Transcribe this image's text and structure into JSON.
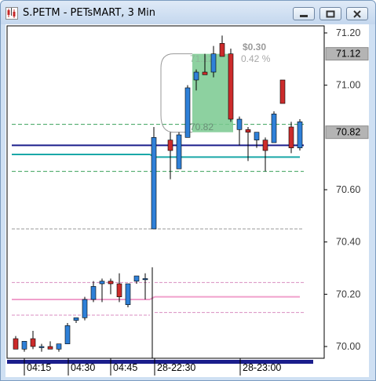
{
  "window": {
    "title": "S.PETM - PETsMART, 3 Min",
    "icons": {
      "app": "candlestick-chart-icon",
      "minimize": "minimize-icon",
      "maximize": "maximize-icon",
      "close": "close-icon"
    }
  },
  "price_axis": {
    "labels": [
      "71.20",
      "71.00",
      "70.60",
      "70.40",
      "70.20",
      "70.00"
    ],
    "values": [
      71.2,
      71.0,
      70.6,
      70.4,
      70.2,
      70.0
    ],
    "markers": [
      {
        "text": "71.12",
        "value": 71.12
      },
      {
        "text": "70.82",
        "value": 70.82
      }
    ]
  },
  "time_axis": {
    "labels": [
      "04:15",
      "04:30",
      "04:45",
      "28-22:30",
      "28-23:00"
    ]
  },
  "measure": {
    "change_label": "$0.30",
    "percent_label": "0.42 %",
    "high_label": "71.12",
    "low_label": "70.82"
  },
  "colors": {
    "up": "#2f80d8",
    "down": "#cc2b2b",
    "baseline": "#1b1e8c",
    "teal": "#1aa8a8",
    "green_dash": "#3aa05a",
    "pink_line": "#f0a0cc",
    "pink_dash": "#d98ec0",
    "gray_dash": "#9a9a9a",
    "measure_fill": "#79c98f"
  }
}
